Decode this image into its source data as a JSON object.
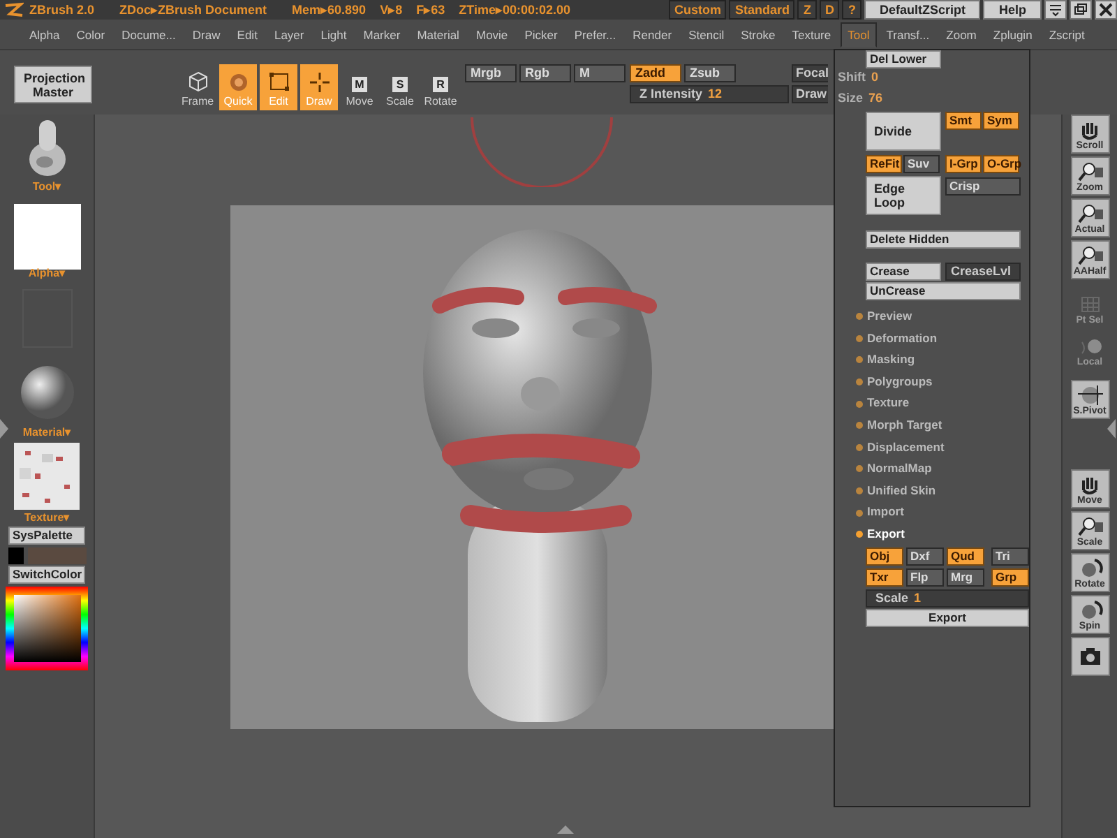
{
  "title_bar": {
    "app": "ZBrush 2.0",
    "document": "ZDoc▸ZBrush Document",
    "stats": [
      "Mem▸60.890",
      "V▸8",
      "F▸63",
      "ZTime▸00:00:02.00"
    ],
    "buttons": [
      {
        "label": "Custom",
        "kind": "orange"
      },
      {
        "label": "Standard",
        "kind": "orange"
      },
      {
        "label": "Z",
        "kind": "orange"
      },
      {
        "label": "D",
        "kind": "orange"
      },
      {
        "label": "?",
        "kind": "orange"
      },
      {
        "label": "DefaultZScript",
        "kind": "light"
      },
      {
        "label": "Help",
        "kind": "light"
      }
    ]
  },
  "menu": [
    {
      "label": "Alpha",
      "selected": false
    },
    {
      "label": "Color",
      "selected": false
    },
    {
      "label": "Docume...",
      "selected": false
    },
    {
      "label": "Draw",
      "selected": false
    },
    {
      "label": "Edit",
      "selected": false
    },
    {
      "label": "Layer",
      "selected": false
    },
    {
      "label": "Light",
      "selected": false
    },
    {
      "label": "Marker",
      "selected": false
    },
    {
      "label": "Material",
      "selected": false
    },
    {
      "label": "Movie",
      "selected": false
    },
    {
      "label": "Picker",
      "selected": false
    },
    {
      "label": "Prefer...",
      "selected": false
    },
    {
      "label": "Render",
      "selected": false
    },
    {
      "label": "Stencil",
      "selected": false
    },
    {
      "label": "Stroke",
      "selected": false
    },
    {
      "label": "Texture",
      "selected": false
    },
    {
      "label": "Tool",
      "selected": true
    },
    {
      "label": "Transf...",
      "selected": false
    },
    {
      "label": "Zoom",
      "selected": false
    },
    {
      "label": "Zplugin",
      "selected": false
    },
    {
      "label": "Zscript",
      "selected": false
    }
  ],
  "toolbar": {
    "projection_master": "Projection Master",
    "modes": [
      {
        "label": "Frame",
        "kind": "cube",
        "on": false
      },
      {
        "label": "Quick",
        "kind": "dot",
        "on": true
      },
      {
        "label": "Edit",
        "kind": "edit",
        "on": true
      },
      {
        "label": "Draw",
        "kind": "cross",
        "on": true
      },
      {
        "label": "Move",
        "kind": "key",
        "key": "M",
        "on": false
      },
      {
        "label": "Scale",
        "kind": "key",
        "key": "S",
        "on": false
      },
      {
        "label": "Rotate",
        "kind": "key",
        "key": "R",
        "on": false
      }
    ],
    "channels": [
      {
        "label": "Mrgb",
        "on": false
      },
      {
        "label": "Rgb",
        "on": false
      },
      {
        "label": "M",
        "on": false
      }
    ],
    "depth": [
      {
        "label": "Zadd",
        "on": true
      },
      {
        "label": "Zsub",
        "on": false
      }
    ],
    "sliders": [
      {
        "label": "Z Intensity",
        "value": "12"
      },
      {
        "label": "Focal",
        "behind_panel": "Shift",
        "value": "0"
      },
      {
        "label": "Draw",
        "behind_panel": "Size",
        "value": "76"
      }
    ]
  },
  "left_shelf": {
    "tool": "Tool▾",
    "alpha": "Alpha▾",
    "material": "Material▾",
    "texture": "Texture▾",
    "sys_palette": "SysPalette",
    "switch_color": "SwitchColor"
  },
  "right_shelf": [
    {
      "label": "Scroll",
      "kind": "hand",
      "disabled": false
    },
    {
      "label": "Zoom",
      "kind": "lens",
      "disabled": false
    },
    {
      "label": "Actual",
      "kind": "lens",
      "disabled": false
    },
    {
      "label": "AAHalf",
      "kind": "lens",
      "disabled": false
    },
    {
      "label": "Pt Sel",
      "kind": "grid",
      "disabled": true
    },
    {
      "label": "Local",
      "kind": "sphere",
      "disabled": true
    },
    {
      "label": "S.Pivot",
      "kind": "pivot",
      "disabled": false
    },
    {
      "label": "Move",
      "kind": "hand",
      "disabled": false
    },
    {
      "label": "Scale",
      "kind": "lens",
      "disabled": false
    },
    {
      "label": "Rotate",
      "kind": "rotate",
      "disabled": false
    },
    {
      "label": "Spin",
      "kind": "rotate",
      "disabled": false
    },
    {
      "kind": "camera",
      "disabled": false
    }
  ],
  "tool_panel": {
    "del_lower": "Del Lower",
    "divide": "Divide",
    "divide_options": [
      {
        "label": "Smt",
        "on": true
      },
      {
        "label": "Sym",
        "on": true
      }
    ],
    "geometry_toggles": [
      {
        "label": "ReFit",
        "on": true
      },
      {
        "label": "Suv",
        "on": false
      },
      {
        "label": "I-Grp",
        "on": true
      },
      {
        "label": "O-Grp",
        "on": true
      }
    ],
    "edge_loop": "Edge Loop",
    "crisp": {
      "label": "Crisp",
      "on": false
    },
    "delete_hidden": "Delete Hidden",
    "crease": "Crease",
    "crease_level": "CreaseLvl",
    "uncrease": "UnCrease",
    "sections": [
      {
        "label": "Preview",
        "expanded": false
      },
      {
        "label": "Deformation",
        "expanded": false
      },
      {
        "label": "Masking",
        "expanded": false
      },
      {
        "label": "Polygroups",
        "expanded": false
      },
      {
        "label": "Texture",
        "expanded": false
      },
      {
        "label": "Morph Target",
        "expanded": false
      },
      {
        "label": "Displacement",
        "expanded": false
      },
      {
        "label": "NormalMap",
        "expanded": false
      },
      {
        "label": "Unified Skin",
        "expanded": false
      },
      {
        "label": "Import",
        "expanded": false
      },
      {
        "label": "Export",
        "expanded": true,
        "options": [
          {
            "label": "Obj",
            "on": true
          },
          {
            "label": "Dxf",
            "on": false
          },
          {
            "label": "Qud",
            "on": true
          },
          {
            "label": "Tri",
            "on": false
          },
          {
            "label": "Txr",
            "on": true
          },
          {
            "label": "Flp",
            "on": false
          },
          {
            "label": "Mrg",
            "on": false
          },
          {
            "label": "Grp",
            "on": true
          }
        ],
        "scale": {
          "label": "Scale",
          "value": "1"
        },
        "button": "Export"
      }
    ]
  }
}
